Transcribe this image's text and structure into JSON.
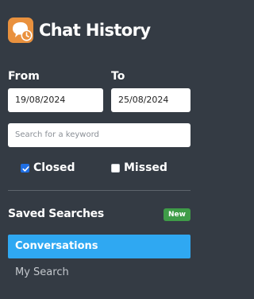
{
  "header": {
    "title": "Chat History",
    "logo_icon": "chat-history-icon",
    "logo_color": "#e9913e"
  },
  "date_range": {
    "from_label": "From",
    "from_value": "19/08/2024",
    "to_label": "To",
    "to_value": "25/08/2024"
  },
  "search": {
    "placeholder": "Search for a keyword",
    "value": ""
  },
  "filters": {
    "closed": {
      "label": "Closed",
      "checked": true
    },
    "missed": {
      "label": "Missed",
      "checked": false
    }
  },
  "saved_searches": {
    "title": "Saved Searches",
    "badge": "New",
    "badge_color": "#3f9c48",
    "items": [
      {
        "label": "Conversations",
        "active": true
      },
      {
        "label": "My Search",
        "active": false
      }
    ]
  },
  "colors": {
    "background": "#343b44",
    "accent": "#2fa8f2",
    "checkbox": "#1f6fe5"
  }
}
